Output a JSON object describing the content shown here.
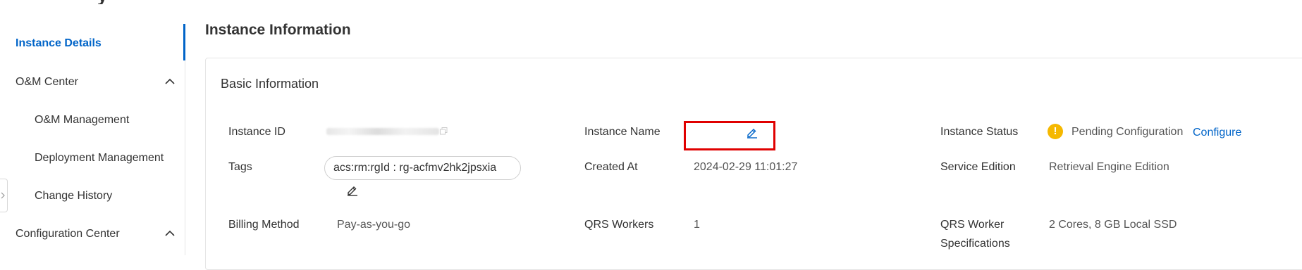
{
  "page": {
    "title_fragment": "y"
  },
  "sidebar": {
    "items": [
      {
        "label": "Instance Details",
        "active": true
      },
      {
        "label": "O&M Center",
        "expandable": true,
        "expanded": true
      },
      {
        "label": "O&M Management",
        "sub": true
      },
      {
        "label": "Deployment Management",
        "sub": true
      },
      {
        "label": "Change History",
        "sub": true
      },
      {
        "label": "Configuration Center",
        "expandable": true,
        "expanded": true
      }
    ]
  },
  "main": {
    "title": "Instance Information",
    "card_title": "Basic Information",
    "fields": {
      "instance_id": {
        "label": "Instance ID",
        "value": ""
      },
      "instance_name": {
        "label": "Instance Name",
        "value": ""
      },
      "instance_status": {
        "label": "Instance Status",
        "value": "Pending Configuration",
        "action": "Configure"
      },
      "tags": {
        "label": "Tags",
        "value": "acs:rm:rgId : rg-acfmv2hk2jpsxia"
      },
      "created_at": {
        "label": "Created At",
        "value": "2024-02-29 11:01:27"
      },
      "service_edition": {
        "label": "Service Edition",
        "value": "Retrieval Engine Edition"
      },
      "billing_method": {
        "label": "Billing Method",
        "value": "Pay-as-you-go"
      },
      "qrs_workers": {
        "label": "QRS Workers",
        "value": "1"
      },
      "qrs_worker_specs": {
        "label_line1": "QRS Worker",
        "label_line2": "Specifications",
        "value": "2 Cores, 8 GB Local SSD"
      }
    }
  },
  "colors": {
    "accent": "#0064c8",
    "warning": "#f5b800",
    "highlight": "#e00000"
  },
  "icons": [
    "chevron-up-icon",
    "edit-icon",
    "copy-icon",
    "warning-icon",
    "collapse-arrow-icon"
  ]
}
